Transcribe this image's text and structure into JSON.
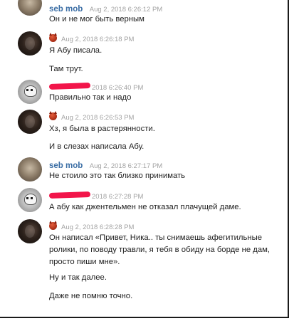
{
  "messages": [
    {
      "author": "seb mob",
      "time": "Aug 2, 2018 6:26:12 PM",
      "lines": [
        "Он и не мог быть верным"
      ]
    },
    {
      "author": "",
      "time": "Aug 2, 2018 6:26:18 PM",
      "lines": [
        "Я Абу писала.",
        "Там трут."
      ]
    },
    {
      "author": "",
      "time": "2018 6:26:40 PM",
      "lines": [
        "Правильно так и надо"
      ]
    },
    {
      "author": "",
      "time": "Aug 2, 2018 6:26:53 PM",
      "lines": [
        "Хз, я была в растерянности.",
        "И в слезах написала Абу."
      ]
    },
    {
      "author": "seb mob",
      "time": "Aug 2, 2018 6:27:17 PM",
      "lines": [
        "Не стоило это так близко принимать"
      ]
    },
    {
      "author": "",
      "time": "2018 6:27:28 PM",
      "lines": [
        "А абу как джентельмен не отказал плачущей даме."
      ]
    },
    {
      "author": "",
      "time": "Aug 2, 2018 6:28:28 PM",
      "lines": [
        "Он написал «Привет, Ника.. ты снимаешь афегитильные ролики, по поводу травли, я тебя в обиду на борде не дам, просто пиши мне».",
        "Ну и так далее.",
        "Даже не помню точно."
      ]
    }
  ]
}
